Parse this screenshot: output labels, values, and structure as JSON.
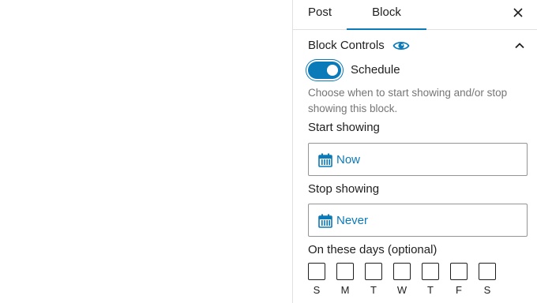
{
  "tabs": {
    "post_label": "Post",
    "block_label": "Block",
    "active": "Block"
  },
  "panel": {
    "title": "Block Controls",
    "title_icon": "eye-icon",
    "expanded": true,
    "toggle": {
      "label": "Schedule",
      "checked": true
    },
    "help_text": "Choose when to start showing and/or stop showing this block.",
    "start": {
      "label": "Start showing",
      "value": "Now",
      "icon": "calendar-icon"
    },
    "stop": {
      "label": "Stop showing",
      "value": "Never",
      "icon": "calendar-icon"
    },
    "days": {
      "label": "On these days (optional)",
      "items": [
        "S",
        "M",
        "T",
        "W",
        "T",
        "F",
        "S"
      ]
    }
  },
  "colors": {
    "accent": "#0a7ab8",
    "text": "#1e1e1e",
    "muted": "#757575",
    "border": "#949494"
  }
}
